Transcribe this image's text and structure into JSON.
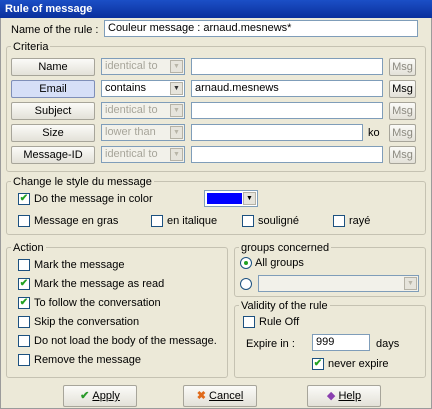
{
  "window": {
    "title": "Rule of message"
  },
  "rule_name": {
    "label": "Name of the rule :",
    "value": "Couleur message : arnaud.mesnews*"
  },
  "criteria": {
    "title": "Criteria",
    "rows": [
      {
        "field": "Name",
        "op": "identical to",
        "value": "",
        "suffix": "",
        "msg": "Msg"
      },
      {
        "field": "Email",
        "op": "contains",
        "value": "arnaud.mesnews",
        "suffix": "",
        "msg": "Msg"
      },
      {
        "field": "Subject",
        "op": "identical to",
        "value": "",
        "suffix": "",
        "msg": "Msg"
      },
      {
        "field": "Size",
        "op": "lower than",
        "value": "",
        "suffix": "ko",
        "msg": "Msg"
      },
      {
        "field": "Message-ID",
        "op": "identical to",
        "value": "",
        "suffix": "",
        "msg": "Msg"
      }
    ]
  },
  "style": {
    "title": "Change le style du message",
    "color_label": "Do the message in color",
    "color_value": "#0000ff",
    "bold": "Message en gras",
    "italic": "en italique",
    "underline": "souligné",
    "strike": "rayé"
  },
  "action": {
    "title": "Action",
    "items": [
      {
        "label": "Mark the message",
        "checked": false
      },
      {
        "label": "Mark the message as read",
        "checked": true
      },
      {
        "label": "To follow the conversation",
        "checked": true
      },
      {
        "label": "Skip the conversation",
        "checked": false
      },
      {
        "label": "Do not load the body of the message.",
        "checked": false
      },
      {
        "label": "Remove the message",
        "checked": false
      }
    ]
  },
  "groups": {
    "title": "groups concerned",
    "all": "All groups"
  },
  "validity": {
    "title": "Validity of the rule",
    "rule_off": "Rule Off",
    "expire_label": "Expire in :",
    "expire_value": "999",
    "days": "days",
    "never": "never expire"
  },
  "buttons": {
    "apply": "Apply",
    "cancel": "Cancel",
    "help": "Help"
  }
}
